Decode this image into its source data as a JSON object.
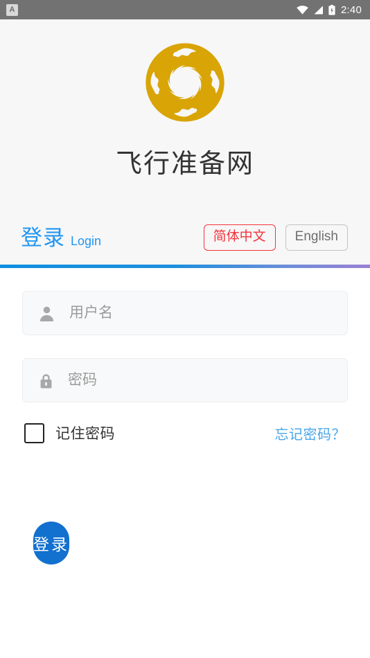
{
  "status_bar": {
    "notification_icon": "app-notification-icon",
    "notification_glyph": "A",
    "wifi_icon": "wifi-icon",
    "signal_icon": "cellular-signal-icon",
    "battery_icon": "battery-icon",
    "time": "2:40",
    "background_color": "#727272"
  },
  "brand": {
    "logo_icon": "sunbird-sun-emblem-logo",
    "logo_color": "#d9a406",
    "app_title": "飞行准备网"
  },
  "tabs": {
    "login_tab_cn": "登录",
    "login_tab_en": "Login",
    "active_color": "#2196f3"
  },
  "language": {
    "options": [
      {
        "label": "简体中文",
        "selected": true,
        "color": "#f4333c"
      },
      {
        "label": "English",
        "selected": false,
        "color": "#6e6e6e"
      }
    ],
    "simplified_chinese": "简体中文",
    "english": "English"
  },
  "divider": {
    "gradient_start": "#0e8fe0",
    "gradient_end": "#9b7fd4"
  },
  "form": {
    "username": {
      "icon": "user-icon",
      "placeholder": "用户名",
      "value": ""
    },
    "password": {
      "icon": "lock-icon",
      "placeholder": "密码",
      "value": ""
    },
    "remember_password_label": "记住密码",
    "remember_password_checked": false,
    "forgot_password_label": "忘记密码？",
    "forgot_password_color": "#49a6ea"
  },
  "actions": {
    "login_button_label": "登录",
    "login_button_color": "#1270ce"
  }
}
